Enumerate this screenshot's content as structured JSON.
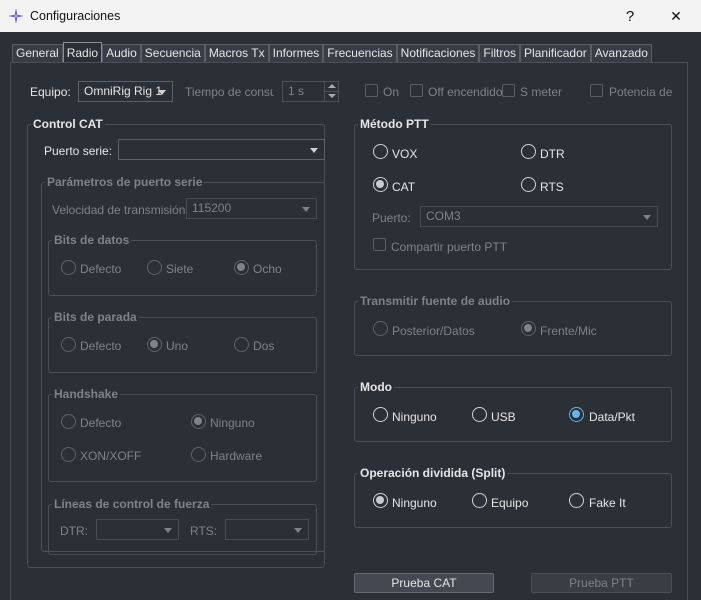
{
  "window": {
    "title": "Configuraciones",
    "help_label": "?",
    "close_label": "✕"
  },
  "tabs": [
    {
      "label": "General",
      "active": false
    },
    {
      "label": "Radio",
      "active": true
    },
    {
      "label": "Audio",
      "active": false
    },
    {
      "label": "Secuencia",
      "active": false
    },
    {
      "label": "Macros Tx",
      "active": false
    },
    {
      "label": "Informes",
      "active": false
    },
    {
      "label": "Frecuencias",
      "active": false
    },
    {
      "label": "Notificaciones",
      "active": false
    },
    {
      "label": "Filtros",
      "active": false
    },
    {
      "label": "Planificador",
      "active": false
    },
    {
      "label": "Avanzado",
      "active": false
    }
  ],
  "top": {
    "equipo_label": "Equipo:",
    "equipo_value": "OmniRig Rig 1",
    "tiempo_label": "Tiempo de consulta",
    "tiempo_value": "1 s",
    "on_label": "On",
    "off_label": "Off encendido",
    "smeter_label": "S meter",
    "potencia_label": "Potencia de s"
  },
  "cat": {
    "title": "Control CAT",
    "puerto_label": "Puerto serie:",
    "puerto_value": "",
    "params": {
      "title": "Parámetros de puerto serie",
      "velocidad_label": "Velocidad de transmisión:",
      "velocidad_value": "115200",
      "bits_datos": {
        "title": "Bits de datos",
        "defecto": "Defecto",
        "siete": "Siete",
        "ocho": "Ocho"
      },
      "bits_parada": {
        "title": "Bits de parada",
        "defecto": "Defecto",
        "uno": "Uno",
        "dos": "Dos"
      },
      "handshake": {
        "title": "Handshake",
        "defecto": "Defecto",
        "ninguno": "Ninguno",
        "xon": "XON/XOFF",
        "hardware": "Hardware"
      }
    },
    "lineas": {
      "title": "Líneas de control de fuerza",
      "dtr_label": "DTR:",
      "dtr_value": "",
      "rts_label": "RTS:",
      "rts_value": ""
    }
  },
  "ptt": {
    "title": "Método PTT",
    "vox": "VOX",
    "dtr": "DTR",
    "cat": "CAT",
    "rts": "RTS",
    "puerto_label": "Puerto:",
    "puerto_value": "COM3",
    "compartir": "Compartir puerto PTT"
  },
  "audio_src": {
    "title": "Transmitir fuente de audio",
    "posterior": "Posterior/Datos",
    "frente": "Frente/Mic"
  },
  "modo": {
    "title": "Modo",
    "ninguno": "Ninguno",
    "usb": "USB",
    "data": "Data/Pkt"
  },
  "split": {
    "title": "Operación dividida (Split)",
    "ninguno": "Ninguno",
    "equipo": "Equipo",
    "fake": "Fake It"
  },
  "buttons": {
    "prueba_cat": "Prueba CAT",
    "prueba_ptt": "Prueba PTT"
  },
  "colors": {
    "accent": "#62b5f0",
    "background": "#2b2f36"
  }
}
